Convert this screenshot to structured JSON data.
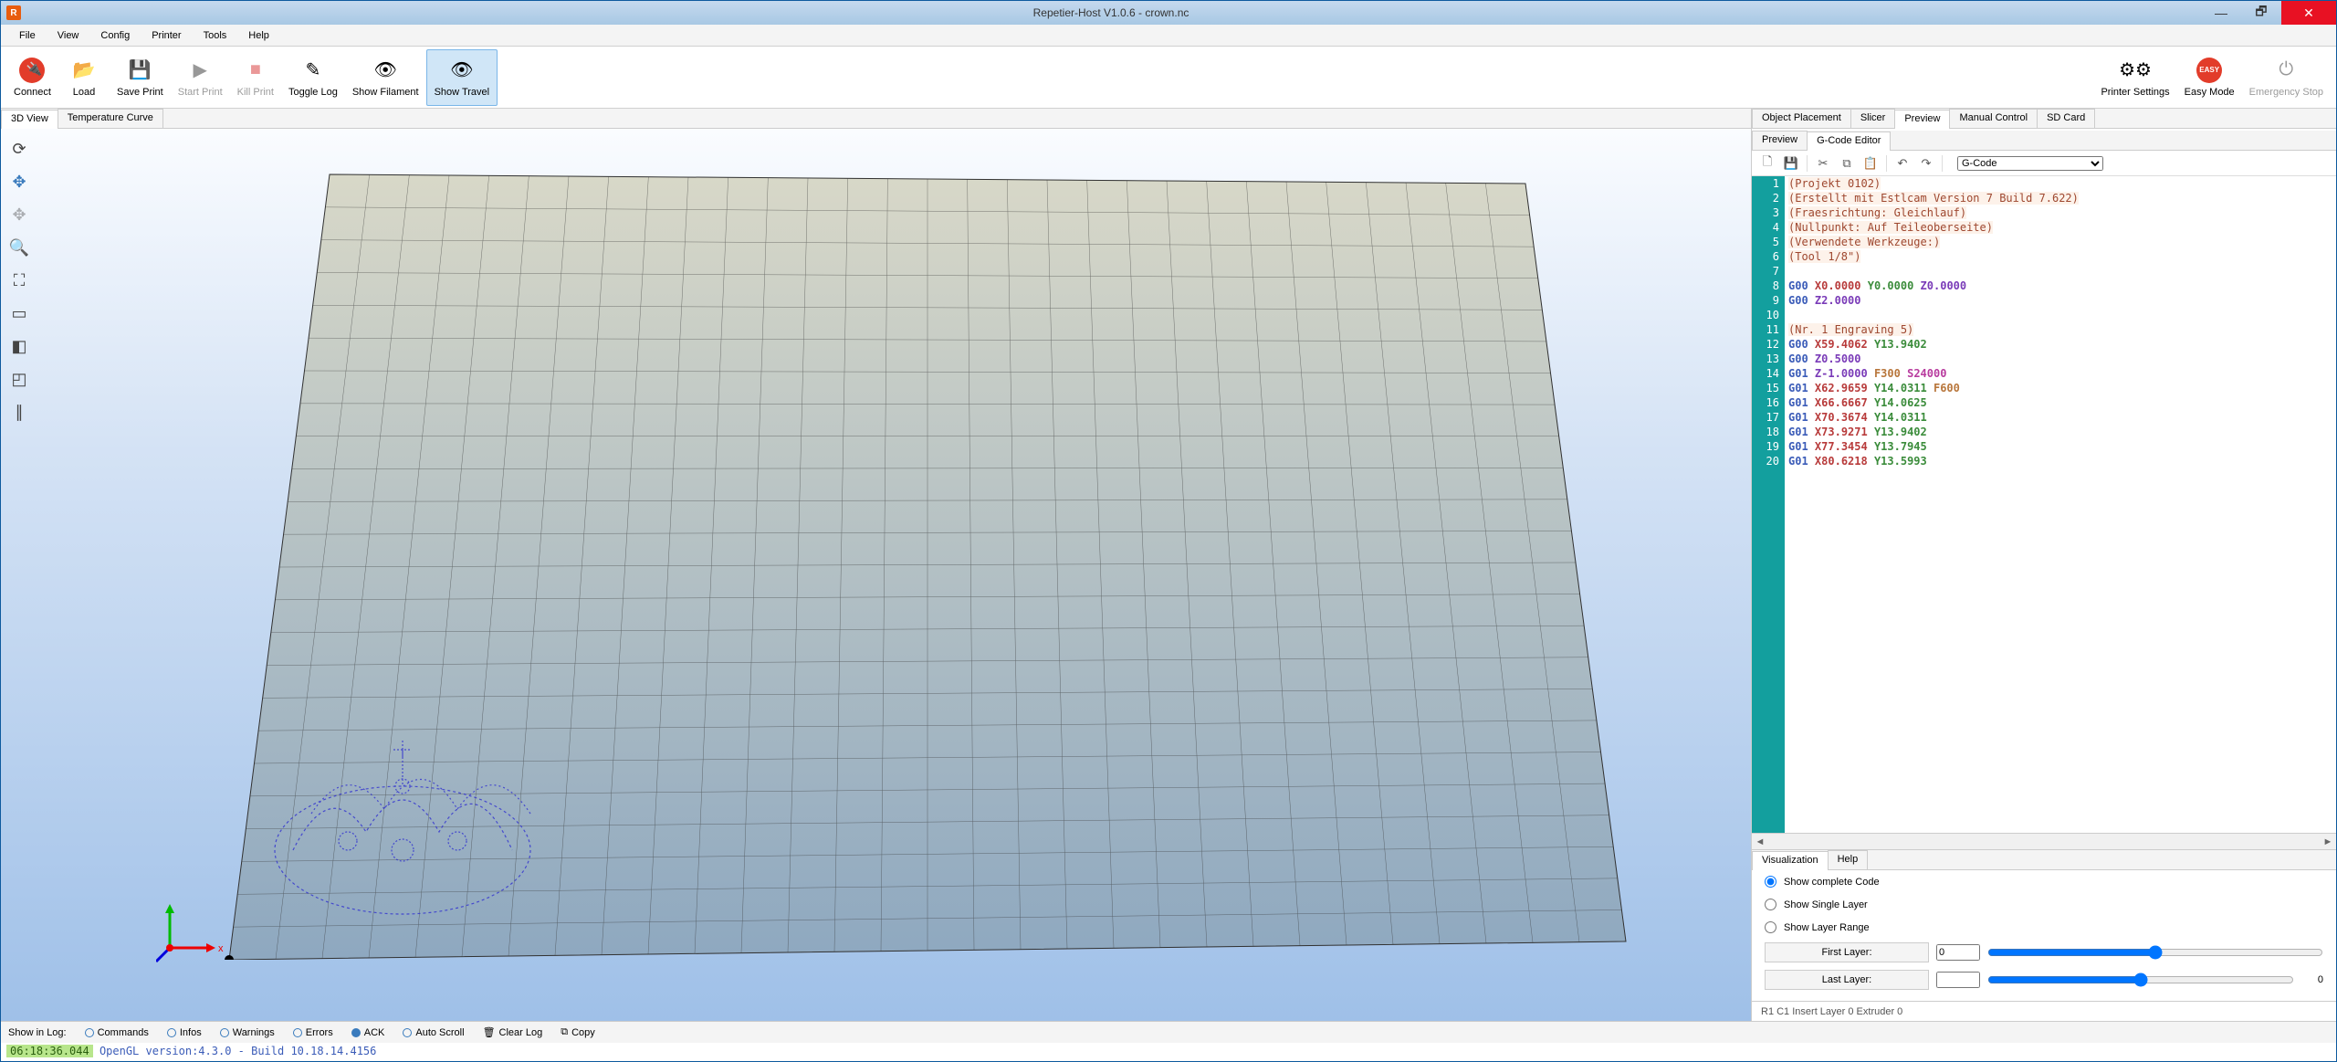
{
  "window": {
    "title": "Repetier-Host V1.0.6 - crown.nc"
  },
  "menu": [
    "File",
    "View",
    "Config",
    "Printer",
    "Tools",
    "Help"
  ],
  "toolbar": {
    "connect": "Connect",
    "load": "Load",
    "saveprint": "Save Print",
    "startprint": "Start Print",
    "killprint": "Kill Print",
    "togglelog": "Toggle Log",
    "showfilament": "Show Filament",
    "showtravel": "Show Travel",
    "printersettings": "Printer Settings",
    "easymode": "Easy Mode",
    "emergency": "Emergency Stop"
  },
  "left_tabs": {
    "t3d": "3D View",
    "temp": "Temperature Curve"
  },
  "right_tabs": {
    "obj": "Object Placement",
    "slicer": "Slicer",
    "preview": "Preview",
    "manual": "Manual Control",
    "sd": "SD Card"
  },
  "preview_subtabs": {
    "preview": "Preview",
    "gcode": "G-Code Editor"
  },
  "gcode_dropdown": "G-Code",
  "code_lines": [
    {
      "n": 1,
      "type": "comment",
      "text": "(Projekt 0102)"
    },
    {
      "n": 2,
      "type": "comment",
      "text": "(Erstellt mit Estlcam Version 7 Build 7.622)"
    },
    {
      "n": 3,
      "type": "comment",
      "text": "(Fraesrichtung: Gleichlauf)"
    },
    {
      "n": 4,
      "type": "comment",
      "text": "(Nullpunkt: Auf Teileoberseite)"
    },
    {
      "n": 5,
      "type": "comment",
      "text": "(Verwendete Werkzeuge:)"
    },
    {
      "n": 6,
      "type": "comment",
      "text": "(Tool 1/8\")"
    },
    {
      "n": 7,
      "type": "blank",
      "text": ""
    },
    {
      "n": 8,
      "type": "code",
      "g": "G00",
      "x": "X0.0000",
      "y": "Y0.0000",
      "z": "Z0.0000"
    },
    {
      "n": 9,
      "type": "code",
      "g": "G00",
      "z": "Z2.0000"
    },
    {
      "n": 10,
      "type": "blank",
      "text": ""
    },
    {
      "n": 11,
      "type": "comment",
      "text": "(Nr. 1 Engraving 5)"
    },
    {
      "n": 12,
      "type": "code",
      "g": "G00",
      "x": "X59.4062",
      "y": "Y13.9402"
    },
    {
      "n": 13,
      "type": "code",
      "g": "G00",
      "z": "Z0.5000"
    },
    {
      "n": 14,
      "type": "code",
      "g": "G01",
      "z": "Z-1.0000",
      "f": "F300",
      "s": "S24000"
    },
    {
      "n": 15,
      "type": "code",
      "g": "G01",
      "x": "X62.9659",
      "y": "Y14.0311",
      "f": "F600"
    },
    {
      "n": 16,
      "type": "code",
      "g": "G01",
      "x": "X66.6667",
      "y": "Y14.0625"
    },
    {
      "n": 17,
      "type": "code",
      "g": "G01",
      "x": "X70.3674",
      "y": "Y14.0311"
    },
    {
      "n": 18,
      "type": "code",
      "g": "G01",
      "x": "X73.9271",
      "y": "Y13.9402"
    },
    {
      "n": 19,
      "type": "code",
      "g": "G01",
      "x": "X77.3454",
      "y": "Y13.7945"
    },
    {
      "n": 20,
      "type": "code",
      "g": "G01",
      "x": "X80.6218",
      "y": "Y13.5993"
    }
  ],
  "vis": {
    "tab_vis": "Visualization",
    "tab_help": "Help",
    "opt_complete": "Show complete Code",
    "opt_single": "Show Single Layer",
    "opt_range": "Show Layer Range",
    "first_layer": "First Layer:",
    "first_val": "0",
    "last_layer": "Last Layer:",
    "last_val": "",
    "range_end": "0"
  },
  "status_editor": "R1  C1  Insert  Layer 0  Extruder 0",
  "logfilter": {
    "label": "Show in Log:",
    "commands": "Commands",
    "infos": "Infos",
    "warnings": "Warnings",
    "errors": "Errors",
    "ack": "ACK",
    "autoscroll": "Auto Scroll",
    "clear": "Clear Log",
    "copy": "Copy"
  },
  "log": {
    "ts": "06:18:36.044",
    "msg": "OpenGL version:4.3.0 - Build 10.18.14.4156"
  }
}
